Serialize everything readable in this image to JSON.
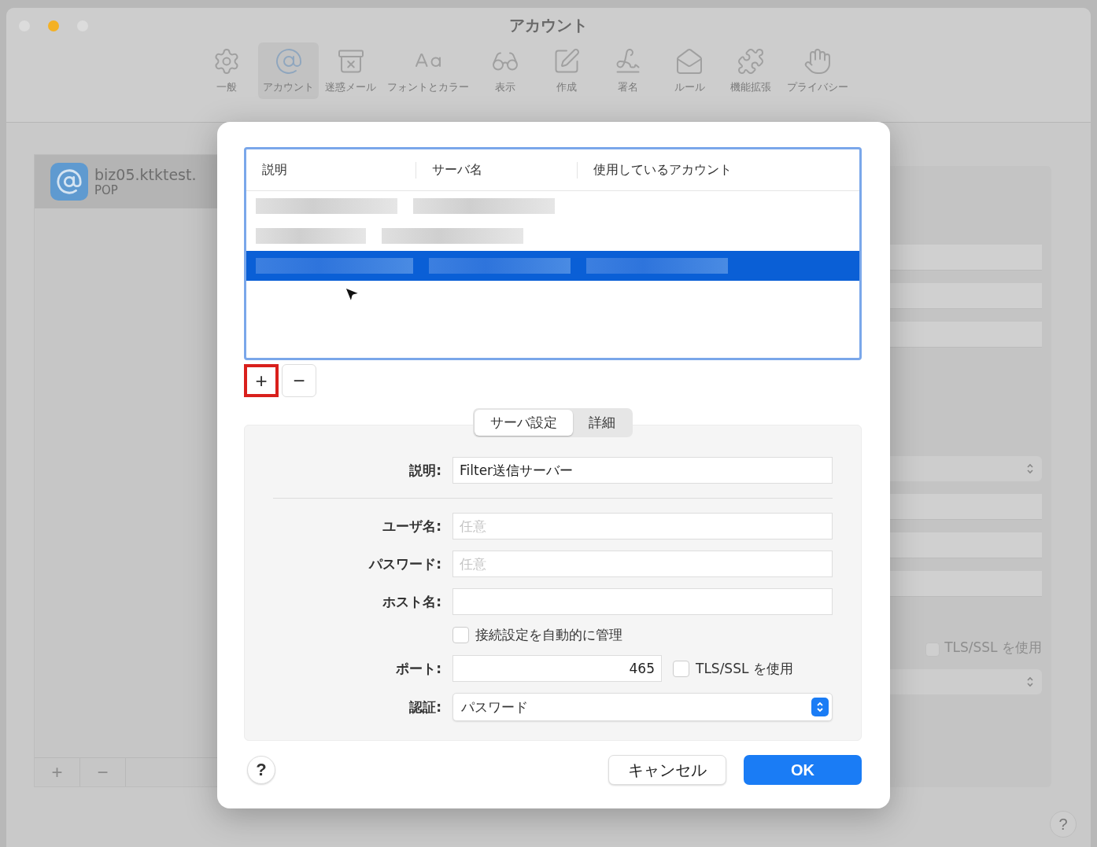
{
  "window": {
    "title": "アカウント"
  },
  "toolbar": [
    {
      "label": "一般",
      "selected": false
    },
    {
      "label": "アカウント",
      "selected": true
    },
    {
      "label": "迷惑メール",
      "selected": false
    },
    {
      "label": "フォントとカラー",
      "selected": false
    },
    {
      "label": "表示",
      "selected": false
    },
    {
      "label": "作成",
      "selected": false
    },
    {
      "label": "署名",
      "selected": false
    },
    {
      "label": "ルール",
      "selected": false
    },
    {
      "label": "機能拡張",
      "selected": false
    },
    {
      "label": "プライバシー",
      "selected": false
    }
  ],
  "sidebar": {
    "accounts": [
      {
        "name": "biz05.ktktest.",
        "type": "POP",
        "selected": true
      }
    ],
    "buttons": [
      "+",
      "−"
    ]
  },
  "background_panel": {
    "items": [
      {
        "kind": "field"
      },
      {
        "kind": "field"
      },
      {
        "kind": "field"
      },
      {
        "kind": "gap"
      },
      {
        "kind": "popup"
      },
      {
        "kind": "field"
      },
      {
        "kind": "field"
      },
      {
        "kind": "field"
      },
      {
        "kind": "checkbox",
        "label": "TLS/SSL を使用",
        "checked": false
      },
      {
        "kind": "popup"
      }
    ]
  },
  "help_button": "?",
  "dialog": {
    "table": {
      "columns": [
        "説明",
        "サーバ名",
        "使用しているアカウント"
      ],
      "rows": [
        {
          "selected": false
        },
        {
          "selected": false
        },
        {
          "selected": true
        }
      ]
    },
    "add_button": {
      "label": "+",
      "highlighted": true
    },
    "remove_button": {
      "label": "−"
    },
    "tabs": [
      {
        "label": "サーバ設定",
        "selected": true
      },
      {
        "label": "詳細",
        "selected": false
      }
    ],
    "form": {
      "description": {
        "label": "説明:",
        "value": "Filter送信サーバー"
      },
      "username": {
        "label": "ユーザ名:",
        "placeholder": "任意"
      },
      "password": {
        "label": "パスワード:",
        "placeholder": "任意"
      },
      "host": {
        "label": "ホスト名:"
      },
      "auto_manage": {
        "label": "接続設定を自動的に管理",
        "checked": false
      },
      "port": {
        "label": "ポート:",
        "value": "465"
      },
      "tls": {
        "label": "TLS/SSL を使用",
        "checked": false
      },
      "auth": {
        "label": "認証:",
        "value": "パスワード"
      }
    },
    "help_button": "?",
    "cancel_button": "キャンセル",
    "ok_button": "OK"
  }
}
